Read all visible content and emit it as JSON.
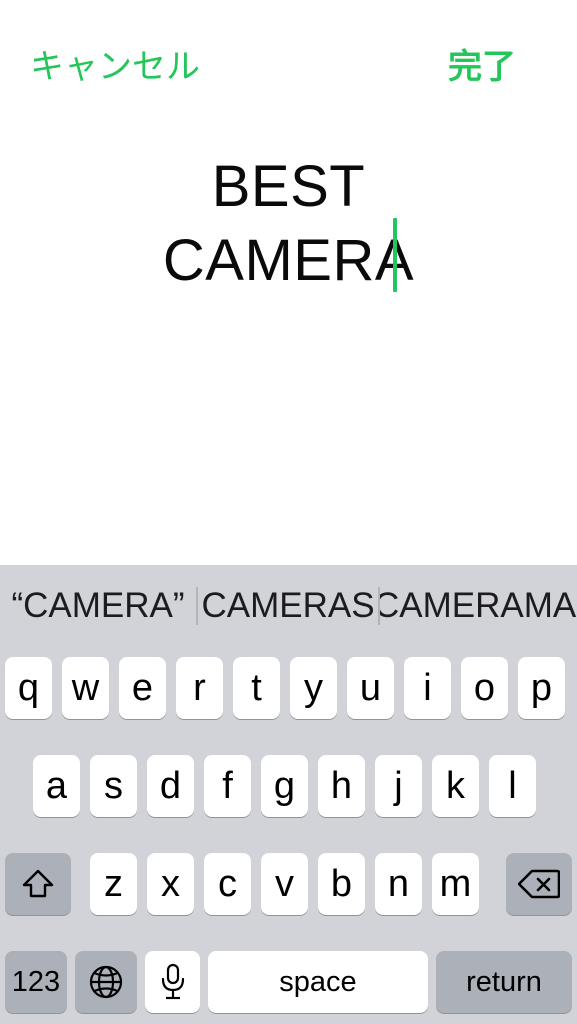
{
  "topbar": {
    "cancel_label": "キャンセル",
    "done_label": "完了",
    "accent_color": "#24c65a"
  },
  "editor": {
    "text": "BEST\nCAMERA",
    "caret_color": "#22c55e",
    "text_color": "#0a0a0a"
  },
  "keyboard": {
    "background_color": "#d1d3d9",
    "key_color": "#ffffff",
    "special_key_color": "#acb0b9",
    "suggestions": [
      {
        "label": "“CAMERA”"
      },
      {
        "label": "CAMERAS"
      },
      {
        "label": "CAMERAMAN"
      }
    ],
    "row1": [
      {
        "label": "q"
      },
      {
        "label": "w"
      },
      {
        "label": "e"
      },
      {
        "label": "r"
      },
      {
        "label": "t"
      },
      {
        "label": "y"
      },
      {
        "label": "u"
      },
      {
        "label": "i"
      },
      {
        "label": "o"
      },
      {
        "label": "p"
      }
    ],
    "row2": [
      {
        "label": "a"
      },
      {
        "label": "s"
      },
      {
        "label": "d"
      },
      {
        "label": "f"
      },
      {
        "label": "g"
      },
      {
        "label": "h"
      },
      {
        "label": "j"
      },
      {
        "label": "k"
      },
      {
        "label": "l"
      }
    ],
    "row3": [
      {
        "label": "z"
      },
      {
        "label": "x"
      },
      {
        "label": "c"
      },
      {
        "label": "v"
      },
      {
        "label": "b"
      },
      {
        "label": "n"
      },
      {
        "label": "m"
      }
    ],
    "shift_icon": "shift-arrow-icon",
    "backspace_icon": "backspace-delete-icon",
    "numbers_label": "123",
    "globe_icon": "globe-icon",
    "mic_icon": "microphone-icon",
    "space_label": "space",
    "return_label": "return"
  }
}
